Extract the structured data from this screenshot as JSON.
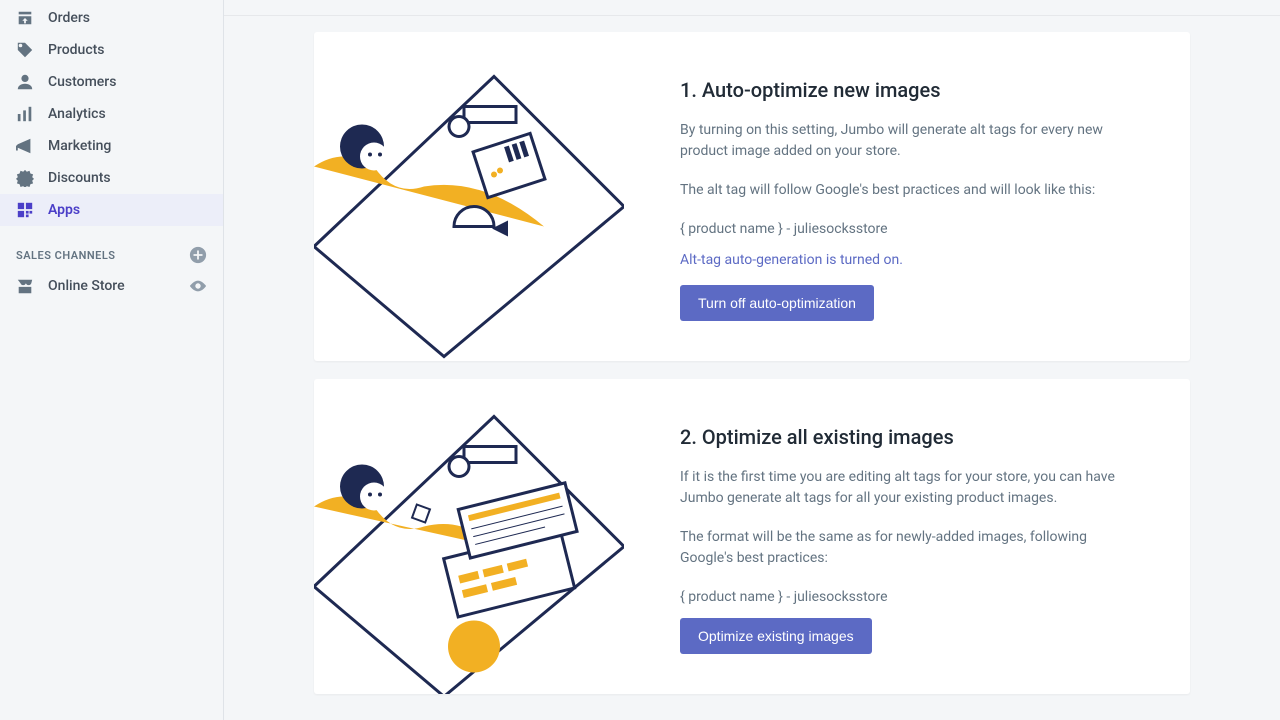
{
  "sidebar": {
    "items": [
      {
        "label": "Orders"
      },
      {
        "label": "Products"
      },
      {
        "label": "Customers"
      },
      {
        "label": "Analytics"
      },
      {
        "label": "Marketing"
      },
      {
        "label": "Discounts"
      },
      {
        "label": "Apps"
      }
    ],
    "channels_header": "SALES CHANNELS",
    "channels": [
      {
        "label": "Online Store"
      }
    ]
  },
  "cards": [
    {
      "title": "1. Auto-optimize new images",
      "p1": "By turning on this setting, Jumbo will generate alt tags for every new product image added on your store.",
      "p2": "The alt tag will follow Google's best practices and will look like this:",
      "template": "{ product name } - juliesocksstore",
      "status": "Alt-tag auto-generation is turned on.",
      "button": "Turn off auto-optimization"
    },
    {
      "title": "2. Optimize all existing images",
      "p1": "If it is the first time you are editing alt tags for your store, you can have Jumbo generate alt tags for all your existing product images.",
      "p2": "The format will be the same as for newly-added images, following Google's best practices:",
      "template": "{ product name } - juliesocksstore",
      "button": "Optimize existing images"
    }
  ]
}
